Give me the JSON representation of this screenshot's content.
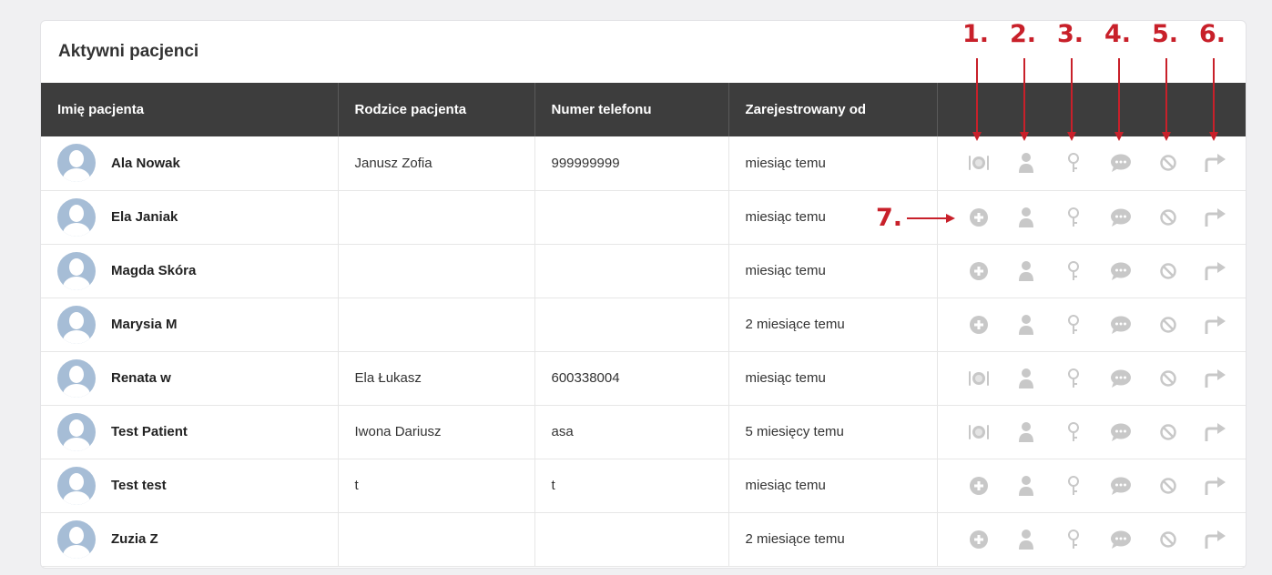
{
  "panel": {
    "title": "Aktywni pacjenci"
  },
  "table": {
    "headers": [
      "Imię pacjenta",
      "Rodzice pacjenta",
      "Numer telefonu",
      "Zarejestrowany od",
      ""
    ],
    "rows": [
      {
        "name": "Ala Nowak",
        "parents": "Janusz Zofia",
        "phone": "999999999",
        "registered": "miesiąc temu",
        "first_action": "diet-icon"
      },
      {
        "name": "Ela Janiak",
        "parents": "",
        "phone": "",
        "registered": "miesiąc temu",
        "first_action": "plus-circle-icon"
      },
      {
        "name": "Magda Skóra",
        "parents": "",
        "phone": "",
        "registered": "miesiąc temu",
        "first_action": "plus-circle-icon"
      },
      {
        "name": "Marysia M",
        "parents": "",
        "phone": "",
        "registered": "2 miesiące temu",
        "first_action": "plus-circle-icon"
      },
      {
        "name": "Renata w",
        "parents": "Ela Łukasz",
        "phone": "600338004",
        "registered": "miesiąc temu",
        "first_action": "diet-icon"
      },
      {
        "name": "Test Patient",
        "parents": "Iwona Dariusz",
        "phone": "asa",
        "registered": "5 miesięcy temu",
        "first_action": "diet-icon"
      },
      {
        "name": "Test test",
        "parents": "t",
        "phone": "t",
        "registered": "miesiąc temu",
        "first_action": "plus-circle-icon"
      },
      {
        "name": "Zuzia Z",
        "parents": "",
        "phone": "",
        "registered": "2 miesiące temu",
        "first_action": "plus-circle-icon"
      }
    ]
  },
  "action_icons": [
    "user-icon",
    "key-icon",
    "chat-icon",
    "block-icon",
    "share-icon"
  ],
  "annotations": {
    "numbers": [
      "1.",
      "2.",
      "3.",
      "4.",
      "5.",
      "6."
    ],
    "side_label": "7."
  },
  "colors": {
    "header_bg": "#3d3d3d",
    "icon": "#c8c8c8",
    "annotation": "#c8202a",
    "avatar": "#a6bdd6"
  }
}
